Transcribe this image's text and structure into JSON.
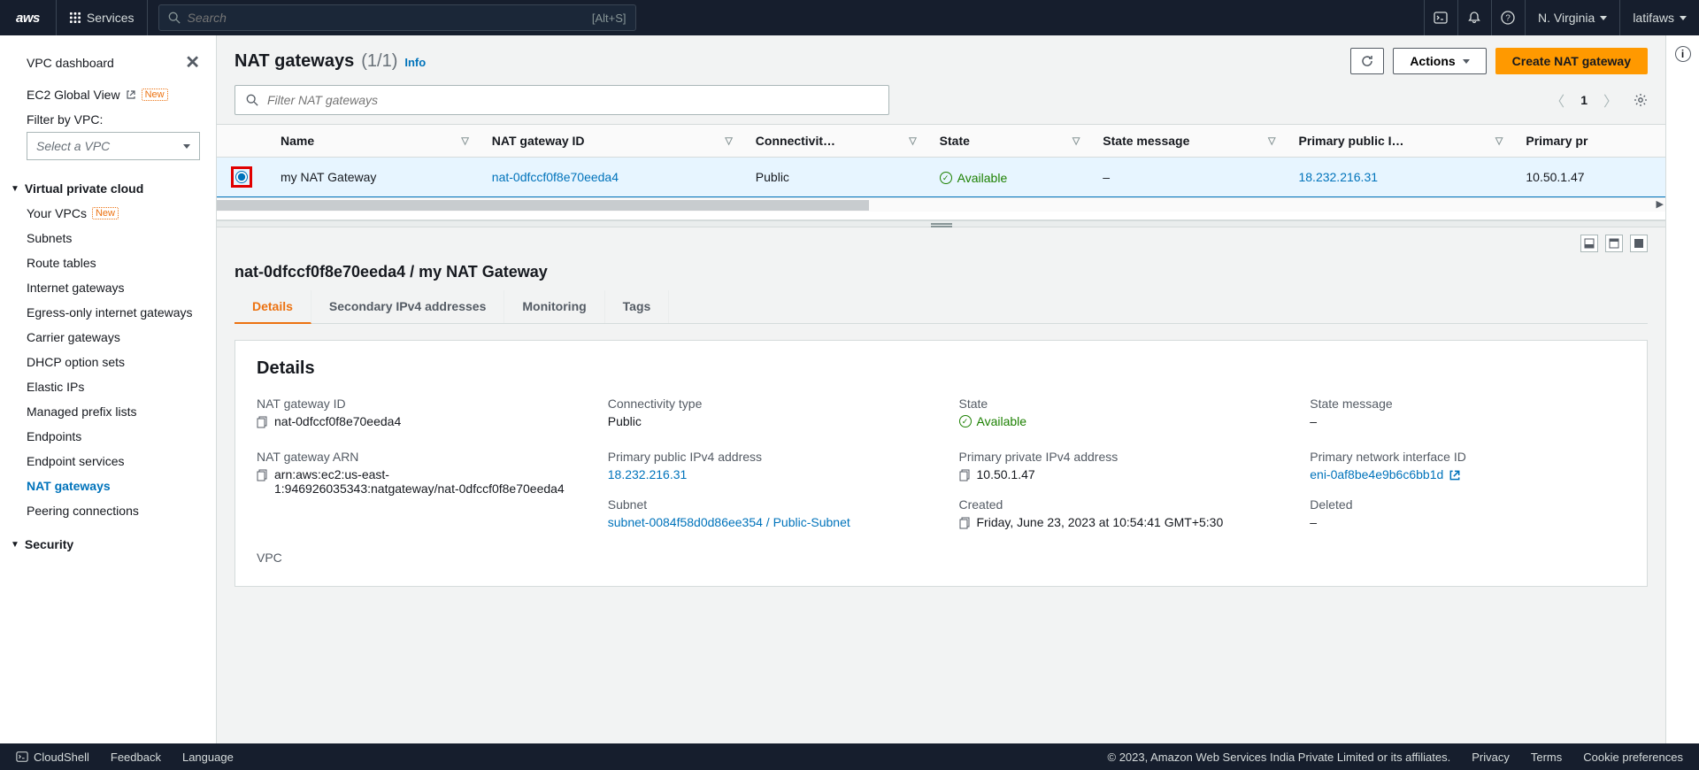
{
  "topnav": {
    "services": "Services",
    "search_placeholder": "Search",
    "search_hint": "[Alt+S]",
    "region": "N. Virginia",
    "account": "latifaws"
  },
  "sidebar": {
    "dashboard": "VPC dashboard",
    "ec2_global": "EC2 Global View",
    "new_badge": "New",
    "filter_label": "Filter by VPC:",
    "select_vpc": "Select a VPC",
    "section_vpc": "Virtual private cloud",
    "items": [
      "Your VPCs",
      "Subnets",
      "Route tables",
      "Internet gateways",
      "Egress-only internet gateways",
      "Carrier gateways",
      "DHCP option sets",
      "Elastic IPs",
      "Managed prefix lists",
      "Endpoints",
      "Endpoint services",
      "NAT gateways",
      "Peering connections"
    ],
    "section_security": "Security"
  },
  "header": {
    "title": "NAT gateways",
    "count": "(1/1)",
    "info": "Info",
    "actions": "Actions",
    "create": "Create NAT gateway"
  },
  "filter": {
    "placeholder": "Filter NAT gateways",
    "page": "1"
  },
  "table": {
    "cols": [
      "Name",
      "NAT gateway ID",
      "Connectivit…",
      "State",
      "State message",
      "Primary public I…",
      "Primary pr"
    ],
    "row": {
      "name": "my NAT Gateway",
      "id": "nat-0dfccf0f8e70eeda4",
      "connectivity": "Public",
      "state": "Available",
      "state_message": "–",
      "public_ip": "18.232.216.31",
      "private_ip": "10.50.1.47"
    }
  },
  "detail": {
    "breadcrumb": "nat-0dfccf0f8e70eeda4 / my NAT Gateway",
    "tabs": [
      "Details",
      "Secondary IPv4 addresses",
      "Monitoring",
      "Tags"
    ],
    "card_title": "Details",
    "fields": {
      "nat_id_label": "NAT gateway ID",
      "nat_id": "nat-0dfccf0f8e70eeda4",
      "conn_label": "Connectivity type",
      "conn": "Public",
      "state_label": "State",
      "state": "Available",
      "state_msg_label": "State message",
      "state_msg": "–",
      "arn_label": "NAT gateway ARN",
      "arn": "arn:aws:ec2:us-east-1:946926035343:natgateway/nat-0dfccf0f8e70eeda4",
      "pub_ip_label": "Primary public IPv4 address",
      "pub_ip": "18.232.216.31",
      "priv_ip_label": "Primary private IPv4 address",
      "priv_ip": "10.50.1.47",
      "eni_label": "Primary network interface ID",
      "eni": "eni-0af8be4e9b6c6bb1d",
      "subnet_label": "Subnet",
      "subnet": "subnet-0084f58d0d86ee354 / Public-Subnet",
      "created_label": "Created",
      "created": "Friday, June 23, 2023 at 10:54:41 GMT+5:30",
      "deleted_label": "Deleted",
      "deleted": "–",
      "vpc_label": "VPC"
    }
  },
  "footer": {
    "cloudshell": "CloudShell",
    "feedback": "Feedback",
    "language": "Language",
    "copyright": "© 2023, Amazon Web Services India Private Limited or its affiliates.",
    "privacy": "Privacy",
    "terms": "Terms",
    "cookies": "Cookie preferences"
  }
}
